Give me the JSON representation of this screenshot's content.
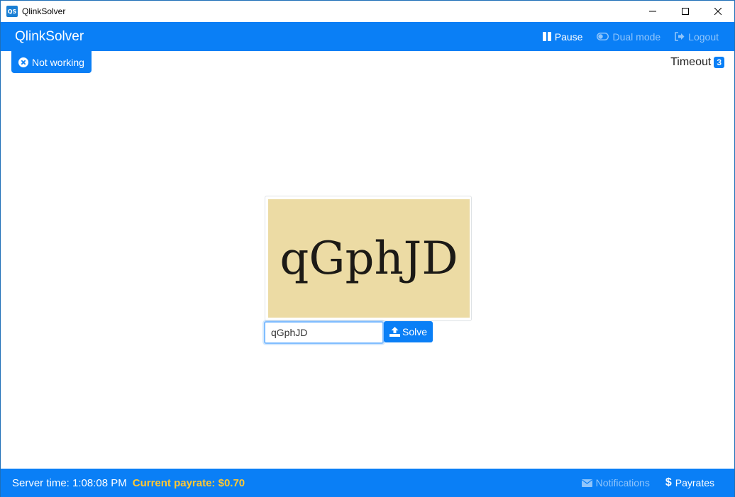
{
  "window": {
    "title": "QlinkSolver",
    "logo_text": "QS"
  },
  "navbar": {
    "brand": "QlinkSolver",
    "items": [
      {
        "label": "Pause",
        "icon": "pause-icon",
        "state": "active"
      },
      {
        "label": "Dual mode",
        "icon": "toggle-icon",
        "state": "muted"
      },
      {
        "label": "Logout",
        "icon": "logout-icon",
        "state": "muted"
      }
    ]
  },
  "status": {
    "label": "Not working",
    "icon": "circle-x-icon"
  },
  "timeout": {
    "label": "Timeout",
    "value": "3"
  },
  "captcha": {
    "image_text": "qGphJD",
    "input_value": "qGphJD",
    "solve_label": "Solve"
  },
  "footer": {
    "server_time": "Server time: 1:08:08 PM",
    "payrate": "Current payrate: $0.70",
    "notifications_label": "Notifications",
    "payrates_label": "Payrates"
  },
  "colors": {
    "primary": "#0a7ff6",
    "payrate": "#ffc833",
    "captcha_bg": "#ecdba4"
  }
}
